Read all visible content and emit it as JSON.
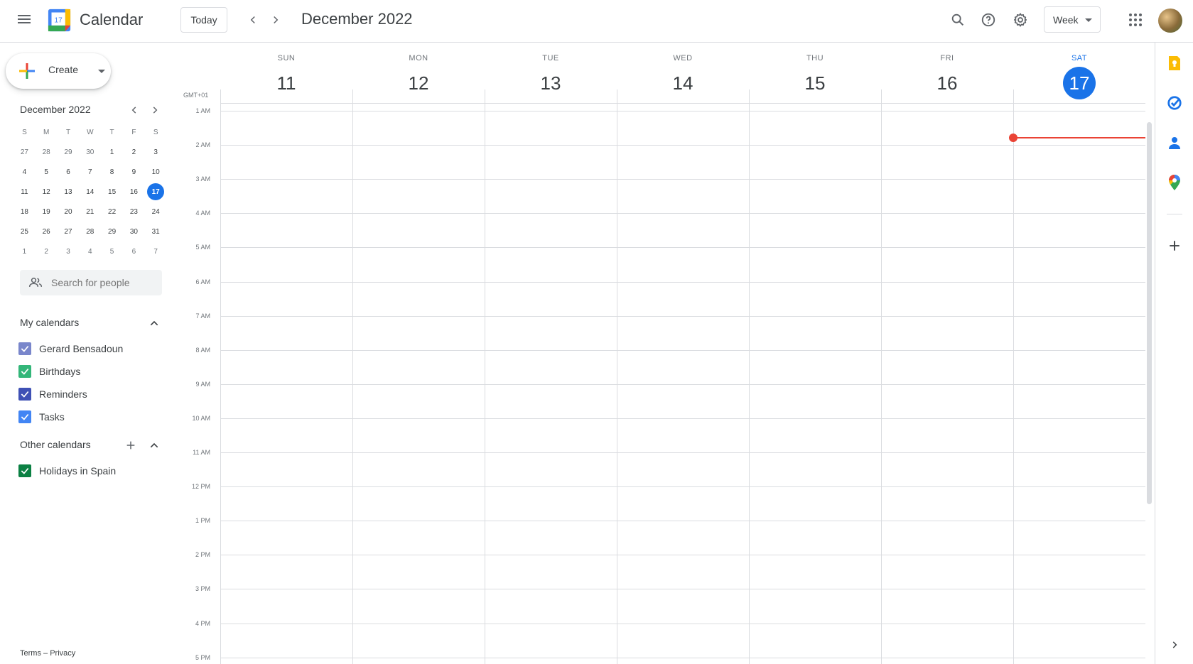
{
  "header": {
    "app_title": "Calendar",
    "logo_day": "17",
    "today_label": "Today",
    "month_title": "December 2022",
    "view_label": "Week"
  },
  "sidebar": {
    "create_label": "Create",
    "mini_calendar": {
      "title": "December 2022",
      "dow": [
        "S",
        "M",
        "T",
        "W",
        "T",
        "F",
        "S"
      ],
      "weeks": [
        [
          "27",
          "28",
          "29",
          "30",
          "1",
          "2",
          "3"
        ],
        [
          "4",
          "5",
          "6",
          "7",
          "8",
          "9",
          "10"
        ],
        [
          "11",
          "12",
          "13",
          "14",
          "15",
          "16",
          "17"
        ],
        [
          "18",
          "19",
          "20",
          "21",
          "22",
          "23",
          "24"
        ],
        [
          "25",
          "26",
          "27",
          "28",
          "29",
          "30",
          "31"
        ],
        [
          "1",
          "2",
          "3",
          "4",
          "5",
          "6",
          "7"
        ]
      ]
    },
    "search_placeholder": "Search for people",
    "my_calendars": {
      "title": "My calendars",
      "items": [
        {
          "label": "Gerard Bensadoun",
          "color": "#7986cb"
        },
        {
          "label": "Birthdays",
          "color": "#33b679"
        },
        {
          "label": "Reminders",
          "color": "#3f51b5"
        },
        {
          "label": "Tasks",
          "color": "#4285f4"
        }
      ]
    },
    "other_calendars": {
      "title": "Other calendars",
      "items": [
        {
          "label": "Holidays in Spain",
          "color": "#0b8043"
        }
      ]
    },
    "footer": {
      "terms": "Terms",
      "sep": "–",
      "privacy": "Privacy"
    }
  },
  "week": {
    "timezone": "GMT+01",
    "days": [
      {
        "dow": "SUN",
        "num": "11"
      },
      {
        "dow": "MON",
        "num": "12"
      },
      {
        "dow": "TUE",
        "num": "13"
      },
      {
        "dow": "WED",
        "num": "14"
      },
      {
        "dow": "THU",
        "num": "15"
      },
      {
        "dow": "FRI",
        "num": "16"
      },
      {
        "dow": "SAT",
        "num": "17"
      }
    ],
    "hours": [
      "1 AM",
      "2 AM",
      "3 AM",
      "4 AM",
      "5 AM",
      "6 AM",
      "7 AM",
      "8 AM",
      "9 AM",
      "10 AM",
      "11 AM",
      "12 PM",
      "1 PM",
      "2 PM",
      "3 PM",
      "4 PM",
      "5 PM"
    ]
  },
  "colors": {
    "accent": "#1a73e8",
    "now_indicator": "#ea4335"
  }
}
